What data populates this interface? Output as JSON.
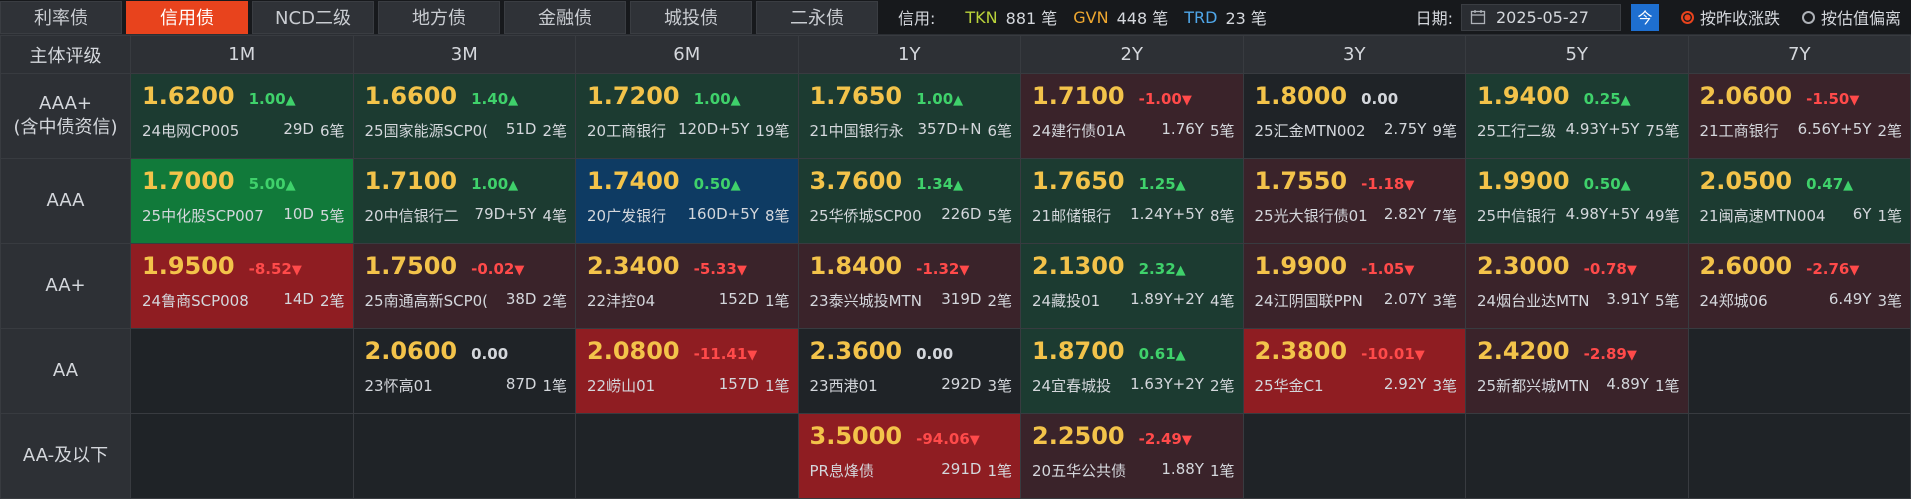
{
  "tabs": [
    {
      "label": "利率债",
      "active": false
    },
    {
      "label": "信用债",
      "active": true
    },
    {
      "label": "NCD二级",
      "active": false
    },
    {
      "label": "地方债",
      "active": false
    },
    {
      "label": "金融债",
      "active": false
    },
    {
      "label": "城投债",
      "active": false
    },
    {
      "label": "二永债",
      "active": false
    }
  ],
  "stats": {
    "label": "信用:",
    "items": [
      {
        "name": "TKN",
        "value": "881 笔",
        "color": "#b9d23a"
      },
      {
        "name": "GVN",
        "value": "448 笔",
        "color": "#f0a830"
      },
      {
        "name": "TRD",
        "value": "23 笔",
        "color": "#4fa6e8"
      }
    ]
  },
  "date": {
    "label": "日期:",
    "value": "2025-05-27",
    "today_label": "今"
  },
  "radios": [
    {
      "label": "按昨收涨跌",
      "selected": true
    },
    {
      "label": "按估值偏离",
      "selected": false
    }
  ],
  "colors": {
    "up": "#3fd16b",
    "down": "#ff4a4a",
    "flat": "#d4d7dc",
    "bg_up_1": "#1c3b31",
    "bg_up_2": "#117a3a",
    "bg_blue": "#0e3b63",
    "bg_down_1": "#3a232a",
    "bg_down_2": "#8f1d22",
    "bg_empty": "#1f2327",
    "accent": "#e8431d",
    "yield": "#f3c34a"
  },
  "grid": {
    "corner": "主体评级",
    "columns": [
      "1M",
      "3M",
      "6M",
      "1Y",
      "2Y",
      "3Y",
      "5Y",
      "7Y"
    ],
    "rows": [
      {
        "rating": "AAA+\n(含中债资信)",
        "cells": [
          {
            "yield": "1.6200",
            "change": "1.00",
            "dir": "up",
            "bond": "24电网CP005",
            "tenor": "29D",
            "count": "6笔",
            "bg": "bg_up_1"
          },
          {
            "yield": "1.6600",
            "change": "1.40",
            "dir": "up",
            "bond": "25国家能源SCP0(",
            "tenor": "51D",
            "count": "2笔",
            "bg": "bg_up_1"
          },
          {
            "yield": "1.7200",
            "change": "1.00",
            "dir": "up",
            "bond": "20工商银行",
            "tenor": "120D+5Y",
            "count": "19笔",
            "bg": "bg_up_1"
          },
          {
            "yield": "1.7650",
            "change": "1.00",
            "dir": "up",
            "bond": "21中国银行永",
            "tenor": "357D+N",
            "count": "6笔",
            "bg": "bg_up_1"
          },
          {
            "yield": "1.7100",
            "change": "-1.00",
            "dir": "down",
            "bond": "24建行债01A",
            "tenor": "1.76Y",
            "count": "5笔",
            "bg": "bg_down_1"
          },
          {
            "yield": "1.8000",
            "change": "0.00",
            "dir": "flat",
            "bond": "25汇金MTN002",
            "tenor": "2.75Y",
            "count": "9笔",
            "bg": "bg_empty"
          },
          {
            "yield": "1.9400",
            "change": "0.25",
            "dir": "up",
            "bond": "25工行二级",
            "tenor": "4.93Y+5Y",
            "count": "75笔",
            "bg": "bg_up_1"
          },
          {
            "yield": "2.0600",
            "change": "-1.50",
            "dir": "down",
            "bond": "21工商银行",
            "tenor": "6.56Y+5Y",
            "count": "2笔",
            "bg": "bg_down_1"
          }
        ]
      },
      {
        "rating": "AAA",
        "cells": [
          {
            "yield": "1.7000",
            "change": "5.00",
            "dir": "up",
            "bond": "25中化股SCP007",
            "tenor": "10D",
            "count": "5笔",
            "bg": "bg_up_2"
          },
          {
            "yield": "1.7100",
            "change": "1.00",
            "dir": "up",
            "bond": "20中信银行二",
            "tenor": "79D+5Y",
            "count": "4笔",
            "bg": "bg_up_1"
          },
          {
            "yield": "1.7400",
            "change": "0.50",
            "dir": "up",
            "bond": "20广发银行",
            "tenor": "160D+5Y",
            "count": "8笔",
            "bg": "bg_blue"
          },
          {
            "yield": "3.7600",
            "change": "1.34",
            "dir": "up",
            "bond": "25华侨城SCP00",
            "tenor": "226D",
            "count": "5笔",
            "bg": "bg_up_1"
          },
          {
            "yield": "1.7650",
            "change": "1.25",
            "dir": "up",
            "bond": "21邮储银行",
            "tenor": "1.24Y+5Y",
            "count": "8笔",
            "bg": "bg_up_1"
          },
          {
            "yield": "1.7550",
            "change": "-1.18",
            "dir": "down",
            "bond": "25光大银行债01",
            "tenor": "2.82Y",
            "count": "7笔",
            "bg": "bg_down_1"
          },
          {
            "yield": "1.9900",
            "change": "0.50",
            "dir": "up",
            "bond": "25中信银行",
            "tenor": "4.98Y+5Y",
            "count": "49笔",
            "bg": "bg_up_1"
          },
          {
            "yield": "2.0500",
            "change": "0.47",
            "dir": "up",
            "bond": "21闽高速MTN004",
            "tenor": "6Y",
            "count": "1笔",
            "bg": "bg_up_1"
          }
        ]
      },
      {
        "rating": "AA+",
        "cells": [
          {
            "yield": "1.9500",
            "change": "-8.52",
            "dir": "down",
            "bond": "24鲁商SCP008",
            "tenor": "14D",
            "count": "2笔",
            "bg": "bg_down_2"
          },
          {
            "yield": "1.7500",
            "change": "-0.02",
            "dir": "down",
            "bond": "25南通高新SCP0(",
            "tenor": "38D",
            "count": "2笔",
            "bg": "bg_down_1"
          },
          {
            "yield": "2.3400",
            "change": "-5.33",
            "dir": "down",
            "bond": "22沣控04",
            "tenor": "152D",
            "count": "1笔",
            "bg": "bg_down_1"
          },
          {
            "yield": "1.8400",
            "change": "-1.32",
            "dir": "down",
            "bond": "23泰兴城投MTN",
            "tenor": "319D",
            "count": "2笔",
            "bg": "bg_down_1"
          },
          {
            "yield": "2.1300",
            "change": "2.32",
            "dir": "up",
            "bond": "24藏投01",
            "tenor": "1.89Y+2Y",
            "count": "4笔",
            "bg": "bg_up_1"
          },
          {
            "yield": "1.9900",
            "change": "-1.05",
            "dir": "down",
            "bond": "24江阴国联PPN",
            "tenor": "2.07Y",
            "count": "3笔",
            "bg": "bg_down_1"
          },
          {
            "yield": "2.3000",
            "change": "-0.78",
            "dir": "down",
            "bond": "24烟台业达MTN",
            "tenor": "3.91Y",
            "count": "5笔",
            "bg": "bg_down_1"
          },
          {
            "yield": "2.6000",
            "change": "-2.76",
            "dir": "down",
            "bond": "24郑城06",
            "tenor": "6.49Y",
            "count": "3笔",
            "bg": "bg_down_1"
          }
        ]
      },
      {
        "rating": "AA",
        "cells": [
          null,
          {
            "yield": "2.0600",
            "change": "0.00",
            "dir": "flat",
            "bond": "23怀高01",
            "tenor": "87D",
            "count": "1笔",
            "bg": "bg_empty"
          },
          {
            "yield": "2.0800",
            "change": "-11.41",
            "dir": "down",
            "bond": "22崂山01",
            "tenor": "157D",
            "count": "1笔",
            "bg": "bg_down_2"
          },
          {
            "yield": "2.3600",
            "change": "0.00",
            "dir": "flat",
            "bond": "23西港01",
            "tenor": "292D",
            "count": "3笔",
            "bg": "bg_empty"
          },
          {
            "yield": "1.8700",
            "change": "0.61",
            "dir": "up",
            "bond": "24宜春城投",
            "tenor": "1.63Y+2Y",
            "count": "2笔",
            "bg": "bg_up_1"
          },
          {
            "yield": "2.3800",
            "change": "-10.01",
            "dir": "down",
            "bond": "25华金C1",
            "tenor": "2.92Y",
            "count": "3笔",
            "bg": "bg_down_2"
          },
          {
            "yield": "2.4200",
            "change": "-2.89",
            "dir": "down",
            "bond": "25新都兴城MTN",
            "tenor": "4.89Y",
            "count": "1笔",
            "bg": "bg_down_1"
          },
          null
        ]
      },
      {
        "rating": "AA-及以下",
        "cells": [
          null,
          null,
          null,
          {
            "yield": "3.5000",
            "change": "-94.06",
            "dir": "down",
            "bond": "PR息烽债",
            "tenor": "291D",
            "count": "1笔",
            "bg": "bg_down_2"
          },
          {
            "yield": "2.2500",
            "change": "-2.49",
            "dir": "down",
            "bond": "20五华公共债",
            "tenor": "1.88Y",
            "count": "1笔",
            "bg": "bg_down_1"
          },
          null,
          null,
          null
        ]
      }
    ]
  }
}
